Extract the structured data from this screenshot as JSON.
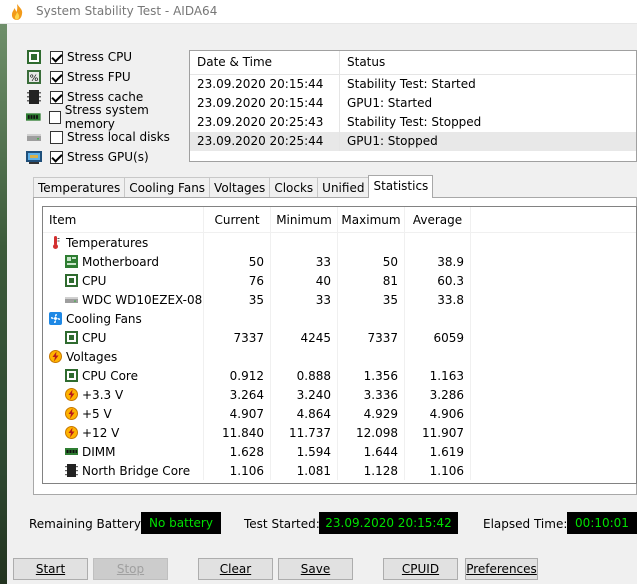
{
  "window": {
    "title": "System Stability Test - AIDA64"
  },
  "stress_options": [
    {
      "label": "Stress CPU",
      "checked": true,
      "icon": "cpu-chip-icon"
    },
    {
      "label": "Stress FPU",
      "checked": true,
      "icon": "fpu-icon"
    },
    {
      "label": "Stress cache",
      "checked": true,
      "icon": "cache-icon"
    },
    {
      "label": "Stress system memory",
      "checked": false,
      "icon": "memory-module-icon"
    },
    {
      "label": "Stress local disks",
      "checked": false,
      "icon": "disk-drive-icon"
    },
    {
      "label": "Stress GPU(s)",
      "checked": true,
      "icon": "gpu-card-icon"
    }
  ],
  "log": {
    "headers": [
      "Date & Time",
      "Status"
    ],
    "rows": [
      {
        "time": "23.09.2020 20:15:44",
        "status": "Stability Test: Started"
      },
      {
        "time": "23.09.2020 20:15:44",
        "status": "GPU1: Started"
      },
      {
        "time": "23.09.2020 20:25:43",
        "status": "Stability Test: Stopped"
      },
      {
        "time": "23.09.2020 20:25:44",
        "status": "GPU1: Stopped"
      }
    ]
  },
  "tabs": [
    "Temperatures",
    "Cooling Fans",
    "Voltages",
    "Clocks",
    "Unified",
    "Statistics"
  ],
  "active_tab": "Statistics",
  "stats": {
    "headers": [
      "Item",
      "Current",
      "Minimum",
      "Maximum",
      "Average"
    ],
    "groups": {
      "temperatures": "Temperatures",
      "cooling": "Cooling Fans",
      "voltages": "Voltages"
    },
    "rows": {
      "t_mb": [
        "Motherboard",
        "50",
        "33",
        "50",
        "38.9"
      ],
      "t_cpu": [
        "CPU",
        "76",
        "40",
        "81",
        "60.3"
      ],
      "t_hdd": [
        "WDC WD10EZEX-08...",
        "35",
        "33",
        "35",
        "33.8"
      ],
      "f_cpu": [
        "CPU",
        "7337",
        "4245",
        "7337",
        "6059"
      ],
      "v_core": [
        "CPU Core",
        "0.912",
        "0.888",
        "1.356",
        "1.163"
      ],
      "v_33": [
        "+3.3 V",
        "3.264",
        "3.240",
        "3.336",
        "3.286"
      ],
      "v_5": [
        "+5 V",
        "4.907",
        "4.864",
        "4.929",
        "4.906"
      ],
      "v_12": [
        "+12 V",
        "11.840",
        "11.737",
        "12.098",
        "11.907"
      ],
      "v_dimm": [
        "DIMM",
        "1.628",
        "1.594",
        "1.644",
        "1.619"
      ],
      "v_nb": [
        "North Bridge Core",
        "1.106",
        "1.081",
        "1.128",
        "1.106"
      ]
    }
  },
  "status": {
    "battery_label": "Remaining Battery:",
    "battery_value": "No battery",
    "started_label": "Test Started:",
    "started_value": "23.09.2020 20:15:42",
    "elapsed_label": "Elapsed Time:",
    "elapsed_value": "00:10:01"
  },
  "buttons": {
    "start": "Start",
    "stop": "Stop",
    "clear": "Clear",
    "save": "Save",
    "cpuid": "CPUID",
    "preferences": "Preferences"
  },
  "colors": {
    "led_text": "#00e000",
    "led_bg": "#000000",
    "selected_row": "#e8e8e8"
  }
}
